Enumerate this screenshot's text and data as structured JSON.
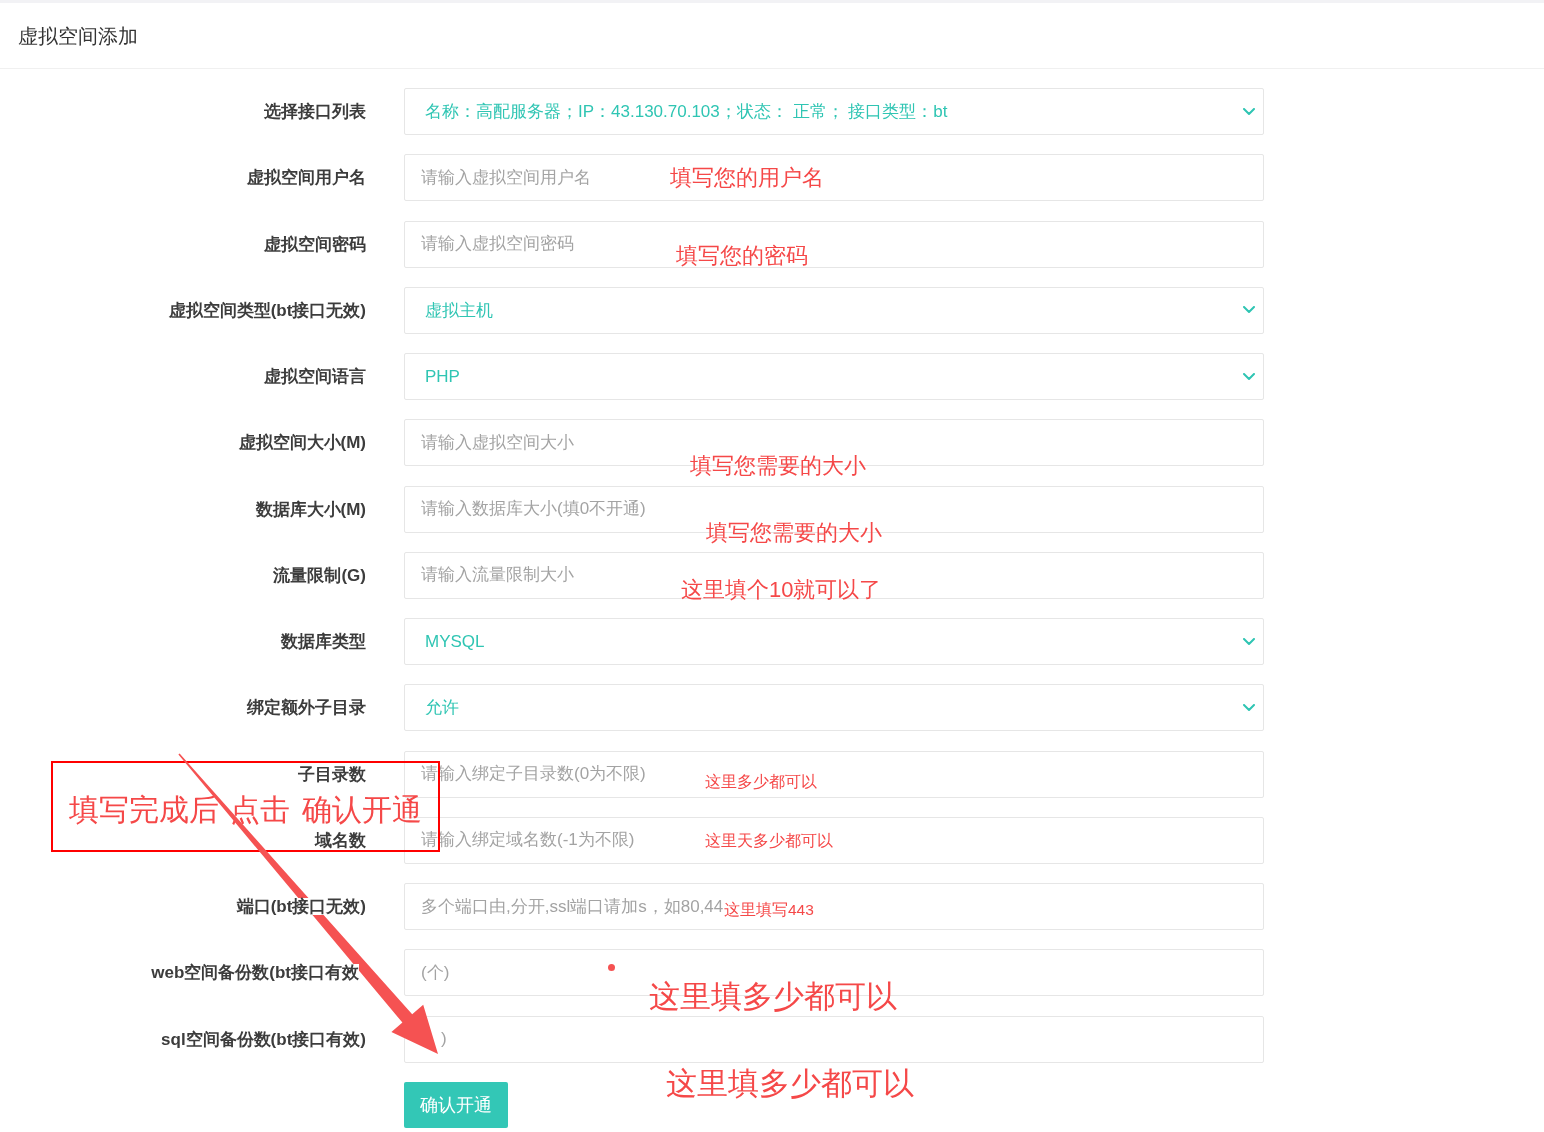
{
  "header": {
    "title": "虚拟空间添加"
  },
  "form": {
    "fields": [
      {
        "kind": "select",
        "label": "选择接口列表",
        "value": "名称：高配服务器；IP：43.130.70.103；状态： 正常； 接口类型：bt"
      },
      {
        "kind": "input",
        "label": "虚拟空间用户名",
        "placeholder": "请输入虚拟空间用户名"
      },
      {
        "kind": "input",
        "label": "虚拟空间密码",
        "placeholder": "请输入虚拟空间密码"
      },
      {
        "kind": "select",
        "label": "虚拟空间类型(bt接口无效)",
        "value": "虚拟主机"
      },
      {
        "kind": "select",
        "label": "虚拟空间语言",
        "value": "PHP"
      },
      {
        "kind": "input",
        "label": "虚拟空间大小(M)",
        "placeholder": "请输入虚拟空间大小"
      },
      {
        "kind": "input",
        "label": "数据库大小(M)",
        "placeholder": "请输入数据库大小(填0不开通)"
      },
      {
        "kind": "input",
        "label": "流量限制(G)",
        "placeholder": "请输入流量限制大小"
      },
      {
        "kind": "select",
        "label": "数据库类型",
        "value": "MYSQL"
      },
      {
        "kind": "select",
        "label": "绑定额外子目录",
        "value": "允许"
      },
      {
        "kind": "input",
        "label": "子目录数",
        "placeholder": "请输入绑定子目录数(0为不限)"
      },
      {
        "kind": "input",
        "label": "域名数",
        "placeholder": "请输入绑定域名数(-1为不限)"
      },
      {
        "kind": "input",
        "label": "端口(bt接口无效)",
        "placeholder": "多个端口由,分开,ssl端口请加s，如80,44"
      },
      {
        "kind": "input",
        "label": "web空间备份数(bt接口有效",
        "placeholder": "(个)"
      },
      {
        "kind": "input",
        "label": "sql空间备份数(bt接口有效)",
        "placeholder": ")"
      }
    ],
    "submit": {
      "label": "确认开通"
    }
  },
  "annotations": [
    {
      "kind": "note",
      "text": "填写您的用户名"
    },
    {
      "kind": "note",
      "text": "填写您的密码"
    },
    {
      "kind": "note",
      "text": "填写您需要的大小"
    },
    {
      "kind": "note",
      "text": "填写您需要的大小"
    },
    {
      "kind": "note",
      "text": "这里填个10就可以了"
    },
    {
      "kind": "callout",
      "text": "填写完成后 点击 确认开通"
    },
    {
      "kind": "note",
      "text": "这里多少都可以"
    },
    {
      "kind": "note",
      "text": "这里天多少都可以"
    },
    {
      "kind": "note",
      "text": "这里填写443"
    },
    {
      "kind": "note",
      "text": "这里填多少都可以"
    },
    {
      "kind": "note",
      "text": "这里填多少都可以"
    }
  ]
}
